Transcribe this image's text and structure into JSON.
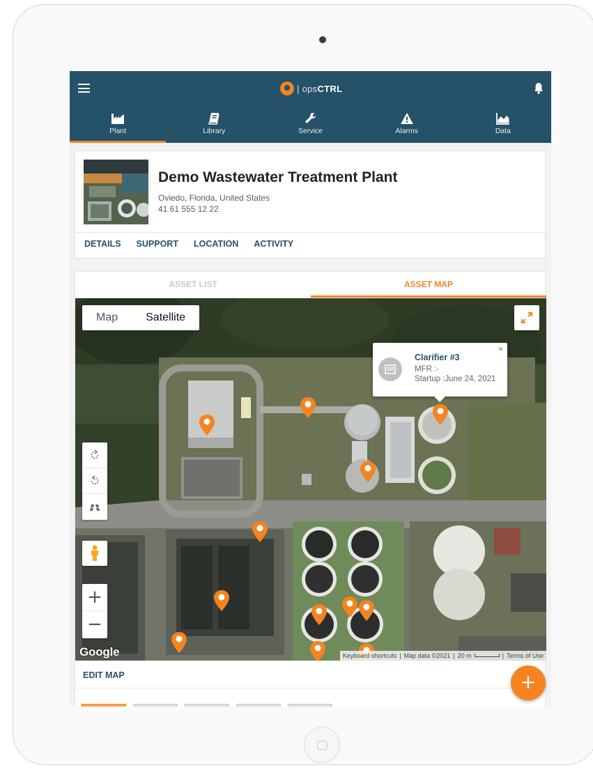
{
  "app": {
    "brand_prefix": "| ops",
    "brand_strong": "CTRL"
  },
  "nav": {
    "tabs": [
      {
        "label": "Plant",
        "icon": "plant-icon",
        "active": true
      },
      {
        "label": "Library",
        "icon": "book-icon",
        "active": false
      },
      {
        "label": "Service",
        "icon": "wrench-icon",
        "active": false
      },
      {
        "label": "Alarms",
        "icon": "alarm-icon",
        "active": false
      },
      {
        "label": "Data",
        "icon": "chart-icon",
        "active": false
      }
    ]
  },
  "plant": {
    "name": "Demo Wastewater Treatment Plant",
    "address": "Oviedo, Florida, United States",
    "phone": "41 61 555 12 22",
    "links": [
      "DETAILS",
      "SUPPORT",
      "LOCATION",
      "ACTIVITY"
    ]
  },
  "assets": {
    "tabs": [
      {
        "label": "ASSET LIST",
        "active": false
      },
      {
        "label": "ASSET MAP",
        "active": true
      }
    ]
  },
  "map": {
    "type_options": [
      "Map",
      "Satellite"
    ],
    "selected_type": "Satellite",
    "zoom_in": "+",
    "zoom_out": "−",
    "logo": "Google",
    "attribution": {
      "shortcuts": "Keyboard shortcuts",
      "data": "Map data ©2021",
      "scale": "20 m",
      "terms": "Terms of Use"
    },
    "popup": {
      "title": "Clarifier #3",
      "mfr": "MFR :-",
      "startup": "Startup :June 24, 2021",
      "close": "×"
    },
    "edit_label": "EDIT MAP"
  },
  "fab": {
    "label": "+"
  },
  "colors": {
    "header": "#255169",
    "accent": "#f5831f"
  }
}
